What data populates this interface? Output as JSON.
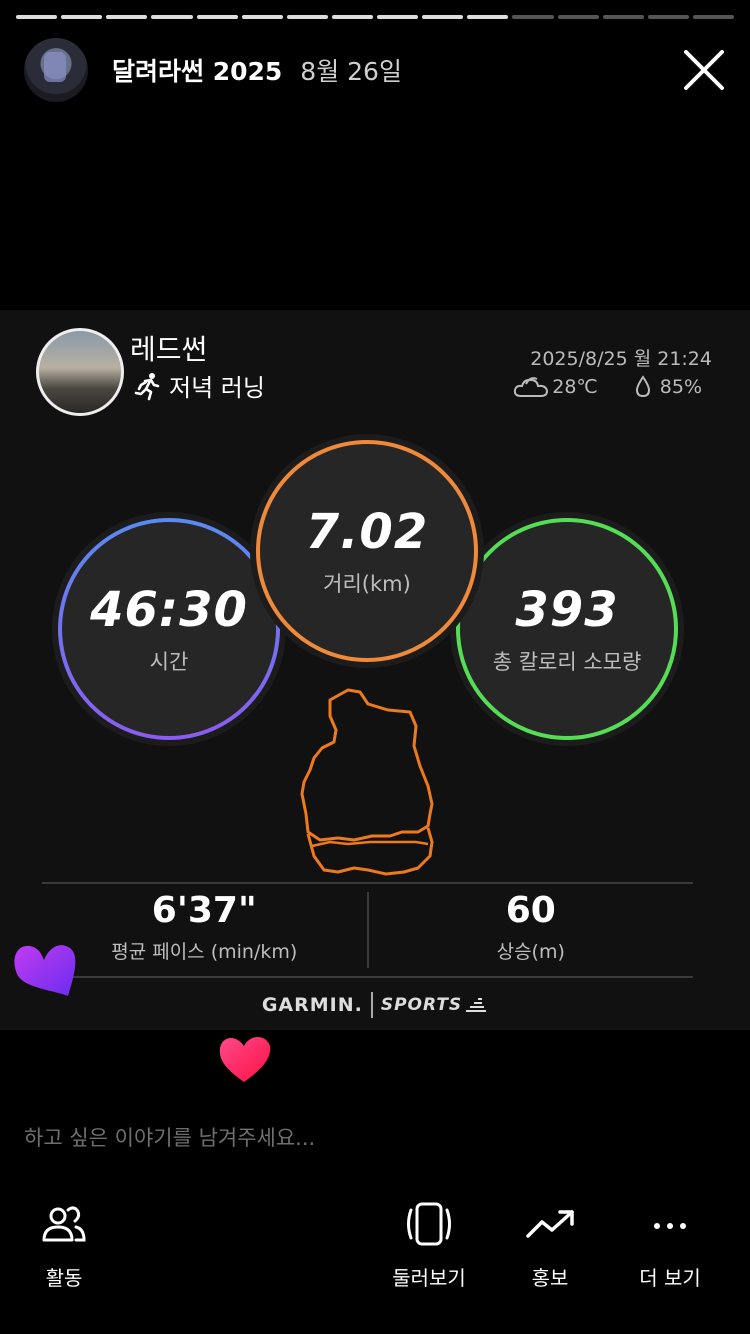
{
  "story": {
    "progress_segments": 16,
    "progress_done": 11,
    "title": "달려라썬 2025",
    "date": "8월 26일"
  },
  "user": {
    "name": "레드썬",
    "activity": "저녁 러닝"
  },
  "activity_meta": {
    "datetime": "2025/8/25 월 21:24",
    "temperature": "28℃",
    "humidity": "85%"
  },
  "metrics": {
    "time": {
      "value": "46:30",
      "label": "시간"
    },
    "distance": {
      "value": "7.02",
      "label": "거리(km)"
    },
    "calories": {
      "value": "393",
      "label": "총 칼로리 소모량"
    }
  },
  "stats": {
    "pace": {
      "value": "6'37\"",
      "label": "평균 페이스 (min/km)"
    },
    "elevation": {
      "value": "60",
      "label": "상승(m)"
    }
  },
  "branding": {
    "brand": "GARMIN.",
    "sub": "SPORTS"
  },
  "message_placeholder": "하고 싶은 이야기를 남겨주세요...",
  "bottom_bar": [
    {
      "id": "activity",
      "label": "활동",
      "icon": "people-icon"
    },
    {
      "id": "rotate",
      "label": "둘러보기",
      "icon": "rotate-phone-icon"
    },
    {
      "id": "promote",
      "label": "홍보",
      "icon": "trending-up-icon"
    },
    {
      "id": "more",
      "label": "더 보기",
      "icon": "more-dots-icon"
    }
  ],
  "colors": {
    "distance_ring": "#ef8a3a",
    "calories_ring": "#55dd55",
    "time_ring_start": "#5a8af0",
    "time_ring_end": "#8a5cf0",
    "route": "#ef7a1a",
    "heart_purple": "#9b3ff0",
    "heart_pink": "#ff2a6d"
  }
}
